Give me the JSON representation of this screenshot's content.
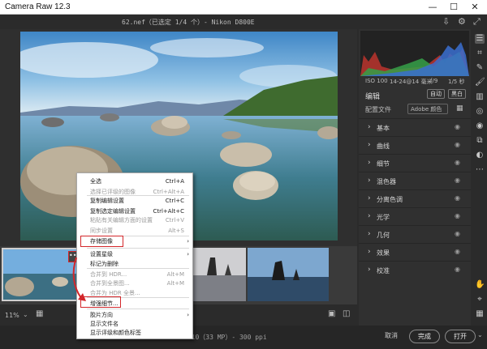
{
  "window": {
    "title": "Camera Raw 12.3",
    "minimize": "—",
    "maximize": "☐",
    "close": "✕"
  },
  "file": {
    "header": "62.nef（已选定 1/4 个）- Nikon D800E"
  },
  "preview": {
    "zoom": "11%"
  },
  "statusbar": {
    "meta": "4710（33 MP）- 300 ppi"
  },
  "footer": {
    "cancel": "取消",
    "done": "完成",
    "open": "打开"
  },
  "panel": {
    "caminfo": {
      "iso": "ISO 100",
      "lens": "14-24@14 毫米",
      "fstop": "f/9",
      "shutter": "1/5 秒"
    },
    "edit_label": "编辑",
    "auto": "自动",
    "bw": "黑白",
    "profile_label": "配置文件",
    "profile_value": "Adobe 颜色",
    "sections": [
      "基本",
      "曲线",
      "细节",
      "混色器",
      "分离色调",
      "光学",
      "几何",
      "效果",
      "校准"
    ]
  },
  "menu": {
    "items": [
      {
        "label": "全选",
        "shortcut": "Ctrl+A",
        "enabled": true
      },
      {
        "label": "选择已评级的图像",
        "shortcut": "Ctrl+Alt+A",
        "enabled": false
      },
      {
        "label": "复制编辑设置",
        "shortcut": "Ctrl+C",
        "enabled": true
      },
      {
        "label": "复制选定编辑设置",
        "shortcut": "Ctrl+Alt+C",
        "enabled": true
      },
      {
        "label": "粘贴有关编辑方面的设置",
        "shortcut": "Ctrl+V",
        "enabled": false
      },
      {
        "label": "同步设置",
        "shortcut": "Alt+S",
        "enabled": false
      },
      {
        "label": "存储图像",
        "shortcut": "",
        "enabled": true
      },
      {
        "label": "设置星级",
        "shortcut": "",
        "enabled": true
      },
      {
        "label": "标记为删除",
        "shortcut": "",
        "enabled": true
      },
      {
        "label": "合并到 HDR...",
        "shortcut": "Alt+M",
        "enabled": false
      },
      {
        "label": "合并到全景图...",
        "shortcut": "Alt+M",
        "enabled": false
      },
      {
        "label": "合并为 HDR 全景...",
        "shortcut": "",
        "enabled": false
      },
      {
        "label": "增强细节...",
        "shortcut": "",
        "enabled": true
      },
      {
        "label": "胶片方向",
        "shortcut": "",
        "enabled": true
      },
      {
        "label": "显示文件名",
        "shortcut": "",
        "enabled": true
      },
      {
        "label": "显示评级和颜色标签",
        "shortcut": "",
        "enabled": true
      }
    ]
  },
  "colors": {
    "highlight": "#d3272b",
    "menu_bg": "#ffffff",
    "panel_bg": "#303030",
    "accent_arrow": "#d3272b"
  }
}
